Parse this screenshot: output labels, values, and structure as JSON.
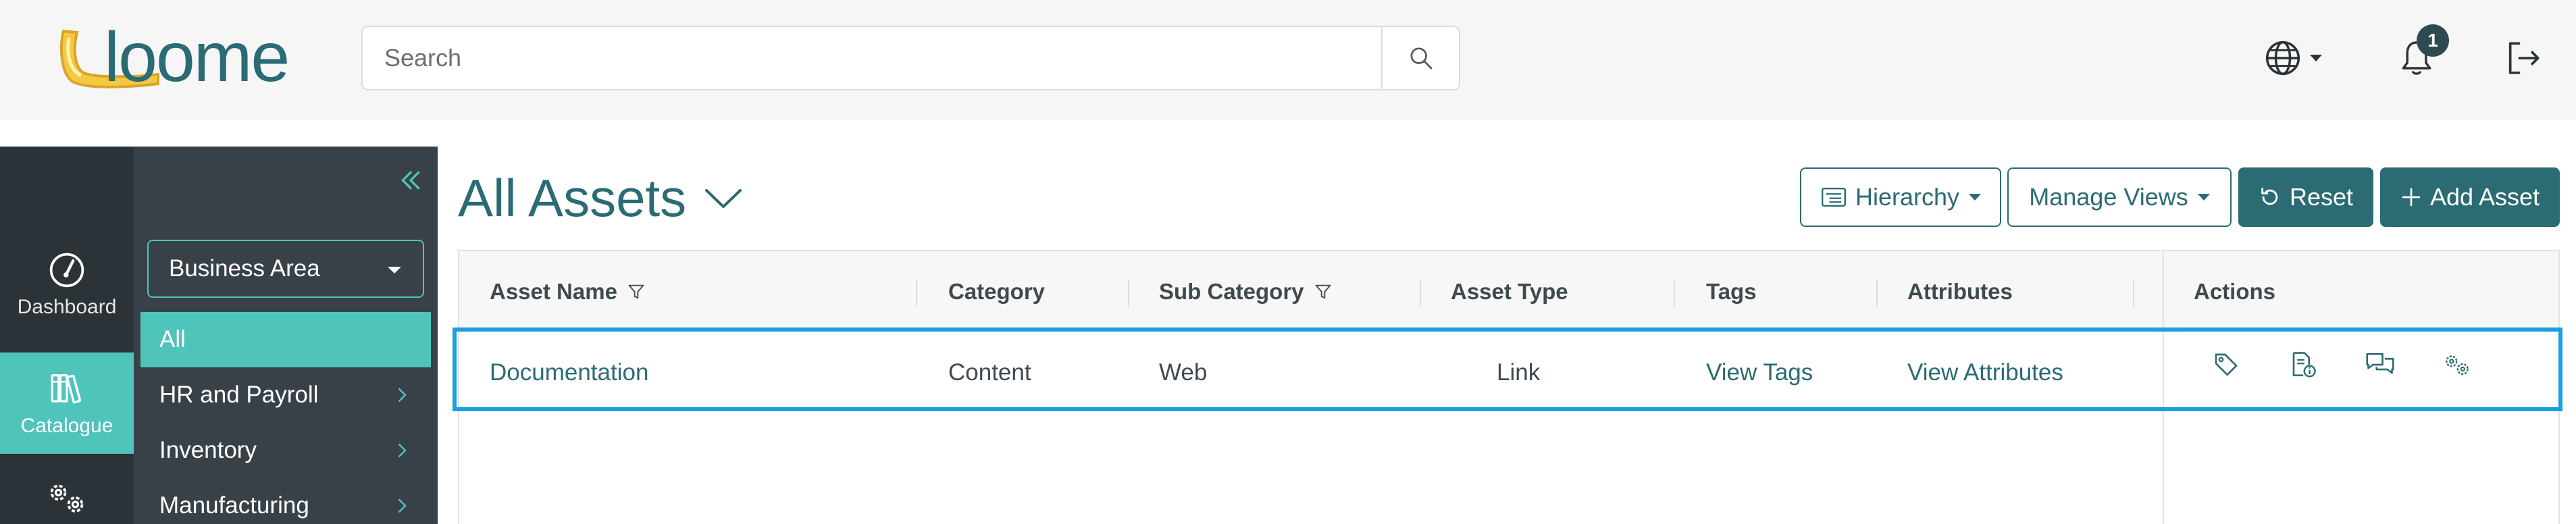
{
  "header": {
    "logo_text": "Loome",
    "search": {
      "placeholder": "Search",
      "value": ""
    },
    "notifications_count": "1"
  },
  "rail": {
    "items": [
      {
        "label": "Dashboard",
        "icon": "dashboard-gauge-icon"
      },
      {
        "label": "Catalogue",
        "icon": "books-icon",
        "active": true
      },
      {
        "label": "",
        "icon": "gears-icon"
      }
    ]
  },
  "category_panel": {
    "selector_label": "Business Area",
    "items": [
      {
        "label": "All",
        "active": true
      },
      {
        "label": "HR and Payroll"
      },
      {
        "label": "Inventory"
      },
      {
        "label": "Manufacturing"
      }
    ]
  },
  "page": {
    "title": "All Assets",
    "buttons": {
      "hierarchy": "Hierarchy",
      "manage_views": "Manage Views",
      "reset": "Reset",
      "add_asset": "Add Asset"
    }
  },
  "table": {
    "columns": [
      "Asset Name",
      "Category",
      "Sub Category",
      "Asset Type",
      "Tags",
      "Attributes",
      "Actions"
    ],
    "rows": [
      {
        "asset_name": "Documentation",
        "category": "Content",
        "sub_category": "Web",
        "asset_type": "Link",
        "tags": "View Tags",
        "attributes": "View Attributes",
        "actions": [
          "tag-icon",
          "document-info-icon",
          "comments-icon",
          "gears-icon"
        ]
      }
    ]
  },
  "colors": {
    "brand_teal": "#2b6b73",
    "accent": "#4ec4bb",
    "highlight": "#1a9fdf",
    "rail_bg": "#2b3338",
    "panel_bg": "#394148"
  }
}
